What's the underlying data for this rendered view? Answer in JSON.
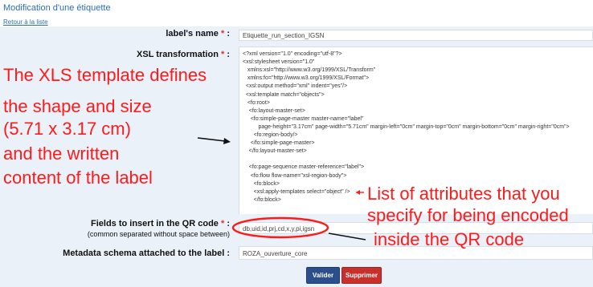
{
  "header": {
    "title": "Modification d'une étiquette",
    "back_link": "Retour à la liste"
  },
  "form": {
    "name_label": "label's name",
    "name_value": "Etiquette_run_section_IGSN",
    "xsl_label": "XSL transformation",
    "required_mark": "*",
    "xsl_lines": [
      "<?xml version=\"1.0\" encoding=\"utf-8\"?>",
      "<xsl:stylesheet version=\"1.0\"",
      "   xmlns:xsl=\"http://www.w3.org/1999/XSL/Transform\"",
      "   xmlns:fo=\"http://www.w3.org/1999/XSL/Format\">",
      "  <xsl:output method=\"xml\" indent=\"yes\"/>",
      "  <xsl:template match=\"objects\">",
      "   <fo:root>",
      "    <fo:layout-master-set>",
      "     <fo:simple-page-master master-name=\"label\"",
      "          page-height=\"3.17cm\" page-width=\"5.71cm\" margin-left=\"0cm\" margin-top=\"0cm\" margin-bottom=\"0cm\" margin-right=\"0cm\">",
      "       <fo:region-body/>",
      "     </fo:simple-page-master>",
      "    </fo:layout-master-set>",
      "",
      "    <fo:page-sequence master-reference=\"label\">",
      "     <fo:flow flow-name=\"xsl-region-body\">",
      "       <fo:block>",
      "       <xsl:apply-templates select=\"object\" />",
      "       </fo:block>"
    ],
    "qr_label": "Fields to insert in the QR code",
    "qr_sub": "(common separated without space between)",
    "qr_value": "db,uid,id,prj,cd,x,y,pi,igsn",
    "meta_label": "Metadata schema attached to the label :",
    "meta_value": "ROZA_ouverture_core",
    "colon": ":",
    "save_label": "Valider",
    "delete_label": "Supprimer"
  },
  "annotations": {
    "left_lines": [
      "The XLS template defines",
      "the shape and size",
      "(5.71 x 3.17 cm)",
      "and the written",
      "content of the label"
    ],
    "right_lines": [
      "List of attributes that you",
      "specify for being encoded",
      "inside the QR code"
    ]
  },
  "colors": {
    "link_blue": "#2a6ebb",
    "annotation_red": "#ff1a1a",
    "save_button": "#2b4e8c",
    "delete_button": "#c9302c",
    "form_background": "#eaf1f8"
  }
}
